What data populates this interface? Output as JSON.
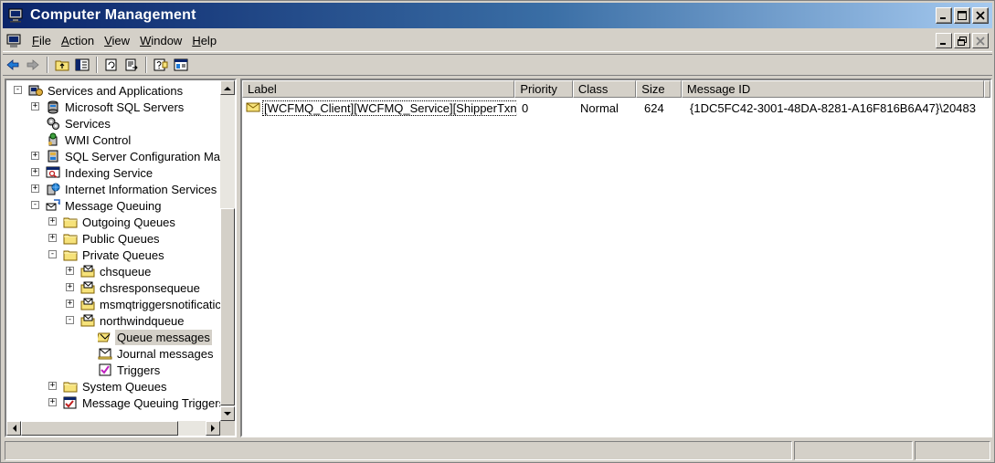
{
  "window": {
    "title": "Computer Management"
  },
  "menu": [
    {
      "label": "File",
      "key": "F",
      "rest": "ile"
    },
    {
      "label": "Action",
      "key": "A",
      "rest": "ction"
    },
    {
      "label": "View",
      "key": "V",
      "rest": "iew"
    },
    {
      "label": "Window",
      "key": "W",
      "rest": "indow"
    },
    {
      "label": "Help",
      "key": "H",
      "rest": "elp"
    }
  ],
  "tree": [
    {
      "label": "Services and Applications",
      "icon": "services-apps-icon",
      "level": 0,
      "expander": "-"
    },
    {
      "label": "Microsoft SQL Servers",
      "icon": "database-icon",
      "level": 1,
      "expander": "+"
    },
    {
      "label": "Services",
      "icon": "gears-icon",
      "level": 1,
      "expander": ""
    },
    {
      "label": "WMI Control",
      "icon": "wmi-icon",
      "level": 1,
      "expander": ""
    },
    {
      "label": "SQL Server Configuration Mar",
      "icon": "sql-config-icon",
      "level": 1,
      "expander": "+"
    },
    {
      "label": "Indexing Service",
      "icon": "indexing-icon",
      "level": 1,
      "expander": "+"
    },
    {
      "label": "Internet Information Services",
      "icon": "iis-icon",
      "level": 1,
      "expander": "+"
    },
    {
      "label": "Message Queuing",
      "icon": "message-queuing-icon",
      "level": 1,
      "expander": "-"
    },
    {
      "label": "Outgoing Queues",
      "icon": "folder-icon",
      "level": 2,
      "expander": "+"
    },
    {
      "label": "Public Queues",
      "icon": "folder-icon",
      "level": 2,
      "expander": "+"
    },
    {
      "label": "Private Queues",
      "icon": "folder-icon",
      "level": 2,
      "expander": "-"
    },
    {
      "label": "chsqueue",
      "icon": "queue-icon",
      "level": 3,
      "expander": "+"
    },
    {
      "label": "chsresponsequeue",
      "icon": "queue-icon",
      "level": 3,
      "expander": "+"
    },
    {
      "label": "msmqtriggersnotificatic",
      "icon": "queue-icon",
      "level": 3,
      "expander": "+"
    },
    {
      "label": "northwindqueue",
      "icon": "queue-icon",
      "level": 3,
      "expander": "-"
    },
    {
      "label": "Queue messages",
      "icon": "queue-messages-icon",
      "level": 4,
      "expander": "",
      "selected": true
    },
    {
      "label": "Journal messages",
      "icon": "journal-messages-icon",
      "level": 4,
      "expander": ""
    },
    {
      "label": "Triggers",
      "icon": "triggers-icon",
      "level": 4,
      "expander": ""
    },
    {
      "label": "System Queues",
      "icon": "folder-icon",
      "level": 2,
      "expander": "+"
    },
    {
      "label": "Message Queuing Triggers",
      "icon": "mq-triggers-icon",
      "level": 2,
      "expander": "+"
    }
  ],
  "list": {
    "columns": [
      "Label",
      "Priority",
      "Class",
      "Size",
      "Message ID"
    ],
    "rows": [
      [
        "[WCFMQ_Client][WCFMQ_Service][ShipperTxn]",
        "0",
        "Normal",
        "624",
        "{1DC5FC42-3001-48DA-8281-A16F816B6A47}\\20483"
      ]
    ]
  },
  "colors": {
    "titlebar_start": "#0a246a",
    "titlebar_end": "#a6caf0",
    "face": "#d4d0c8"
  }
}
